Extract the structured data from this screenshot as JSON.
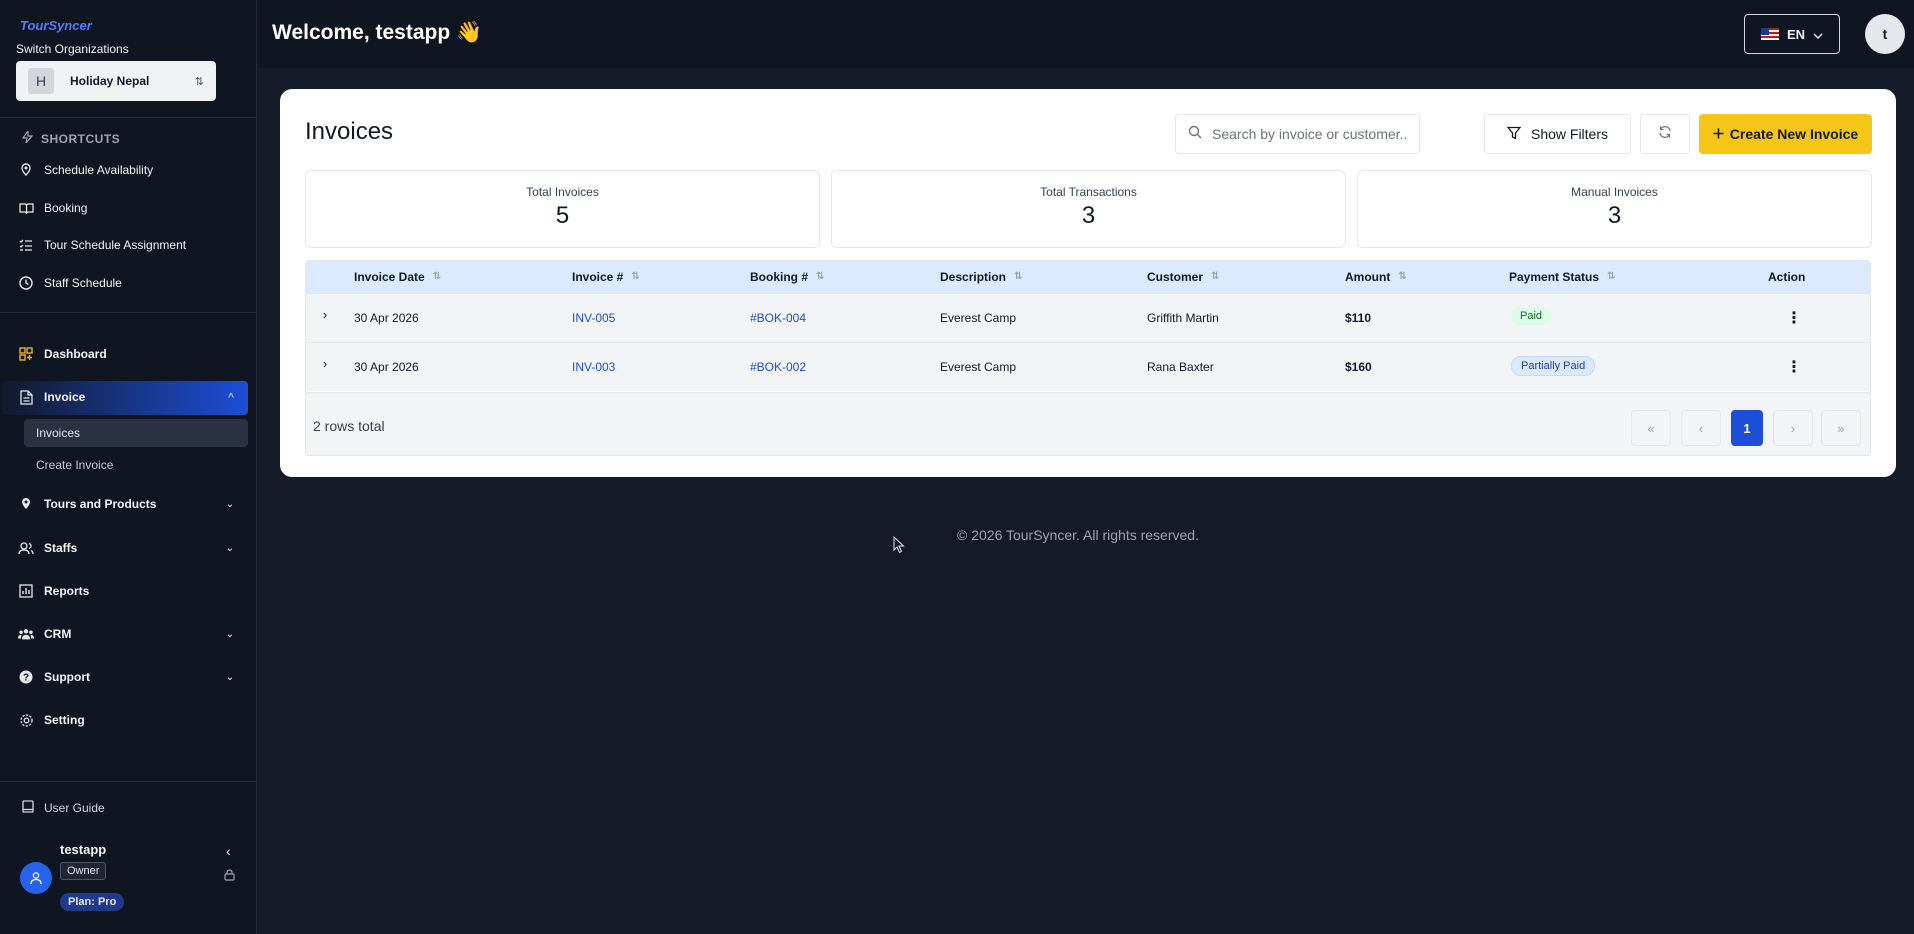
{
  "brand": {
    "logo_text": "TourSyncer"
  },
  "org": {
    "switch_label": "Switch Organizations",
    "initial": "H",
    "name": "Holiday Nepal"
  },
  "shortcuts": {
    "title": "SHORTCUTS",
    "items": [
      {
        "label": "Schedule Availability",
        "icon": "map-pin-icon"
      },
      {
        "label": "Booking",
        "icon": "book-icon"
      },
      {
        "label": "Tour Schedule Assignment",
        "icon": "checklist-icon"
      },
      {
        "label": "Staff Schedule",
        "icon": "clock-icon"
      }
    ]
  },
  "nav": {
    "dashboard": "Dashboard",
    "invoice": "Invoice",
    "invoice_sub": [
      "Invoices",
      "Create Invoice"
    ],
    "tours": "Tours and Products",
    "staffs": "Staffs",
    "reports": "Reports",
    "crm": "CRM",
    "support": "Support",
    "setting": "Setting"
  },
  "user_guide": "User Guide",
  "user": {
    "name": "testapp",
    "role": "Owner",
    "plan": "Plan: Pro",
    "initial": "t"
  },
  "header": {
    "welcome": "Welcome, testapp 👋",
    "lang": "EN"
  },
  "page": {
    "title": "Invoices",
    "search_placeholder": "Search by invoice or customer...",
    "filter_label": "Show Filters",
    "create_label": "Create New Invoice"
  },
  "stats": [
    {
      "label": "Total Invoices",
      "value": "5"
    },
    {
      "label": "Total Transactions",
      "value": "3"
    },
    {
      "label": "Manual Invoices",
      "value": "3"
    }
  ],
  "table": {
    "columns": [
      "Invoice Date",
      "Invoice #",
      "Booking #",
      "Description",
      "Customer",
      "Amount",
      "Payment Status",
      "Action"
    ],
    "rows": [
      {
        "date": "30 Apr 2026",
        "invoice": "INV-005",
        "booking": "#BOK-004",
        "description": "Everest Camp",
        "customer": "Griffith Martin",
        "amount": "$110",
        "status": "Paid"
      },
      {
        "date": "30 Apr 2026",
        "invoice": "INV-003",
        "booking": "#BOK-002",
        "description": "Everest Camp",
        "customer": "Rana Baxter",
        "amount": "$160",
        "status": "Partially Paid"
      }
    ],
    "rows_total": "2 rows total",
    "pagination": {
      "first": "«",
      "prev": "‹",
      "current": "1",
      "next": "›",
      "last": "»"
    }
  },
  "footer": "© 2026 TourSyncer. All rights reserved.",
  "colors": {
    "accent": "#1d4ed8",
    "create_button": "#f5c518",
    "background": "#151a28"
  }
}
